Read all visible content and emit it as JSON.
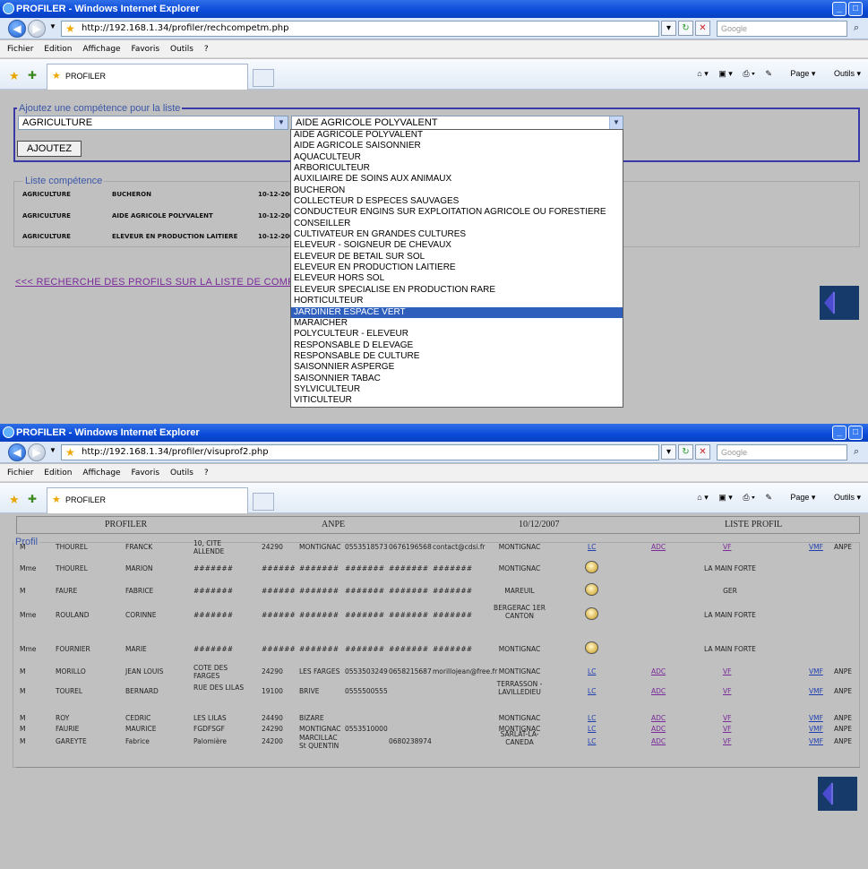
{
  "windows": [
    {
      "title": "PROFILER - Windows Internet Explorer",
      "url": "http://192.168.1.34/profiler/rechcompetm.php",
      "search_placeholder": "Google",
      "menu": [
        "Fichier",
        "Edition",
        "Affichage",
        "Favoris",
        "Outils",
        "?"
      ],
      "tab_label": "PROFILER",
      "tools": [
        "Page",
        "Outils"
      ]
    },
    {
      "title": "PROFILER - Windows Internet Explorer",
      "url": "http://192.168.1.34/profiler/visuprof2.php",
      "search_placeholder": "Google",
      "menu": [
        "Fichier",
        "Edition",
        "Affichage",
        "Favoris",
        "Outils",
        "?"
      ],
      "tab_label": "PROFILER",
      "tools": [
        "Page",
        "Outils"
      ]
    }
  ],
  "form": {
    "legend": "Ajoutez une compétence pour la liste",
    "domain_value": "AGRICULTURE",
    "metier_value": "AIDE AGRICOLE POLYVALENT",
    "button": "AJOUTEZ"
  },
  "liste": {
    "legend": "Liste compétence",
    "rows": [
      [
        "AGRICULTURE",
        "BUCHERON",
        "10-12-200"
      ],
      [
        "AGRICULTURE",
        "AIDE AGRICOLE POLYVALENT",
        "10-12-200"
      ],
      [
        "AGRICULTURE",
        "ELEVEUR EN PRODUCTION LAITIERE",
        "10-12-200"
      ]
    ]
  },
  "link_recherche": "<<< RECHERCHE DES PROFILS SUR LA LISTE DE COMPE",
  "dropdown": {
    "selected_index": 16,
    "options": [
      "AIDE AGRICOLE POLYVALENT",
      "AIDE AGRICOLE SAISONNIER",
      "AQUACULTEUR",
      "ARBORICULTEUR",
      "AUXILIAIRE DE SOINS AUX ANIMAUX",
      "BUCHERON",
      "COLLECTEUR D ESPECES SAUVAGES",
      "CONDUCTEUR ENGINS SUR EXPLOITATION AGRICOLE OU FORESTIERE",
      "CONSEILLER",
      "CULTIVATEUR EN GRANDES CULTURES",
      "ELEVEUR - SOIGNEUR DE CHEVAUX",
      "ELEVEUR DE BETAIL SUR SOL",
      "ELEVEUR EN PRODUCTION LAITIERE",
      "ELEVEUR HORS SOL",
      "ELEVEUR SPECIALISE EN PRODUCTION RARE",
      "HORTICULTEUR",
      "JARDINIER ESPACE VERT",
      "MARAICHER",
      "POLYCULTEUR - ELEVEUR",
      "RESPONSABLE D ELEVAGE",
      "RESPONSABLE DE CULTURE",
      "SAISONNIER ASPERGE",
      "SAISONNIER TABAC",
      "SYLVICULTEUR",
      "VITICULTEUR"
    ]
  },
  "header2": {
    "profiler": "PROFILER",
    "anpe": "ANPE",
    "date": "10/12/2007",
    "liste_profil": "LISTE PROFIL"
  },
  "profil": {
    "legend": "Profil",
    "rows": [
      {
        "civ": "M",
        "nom": "THOUREL",
        "prenom": "FRANCK",
        "adr": "10, CITE ALLENDE",
        "cp": "24290",
        "ville": "MONTIGNAC",
        "tel1": "0553518573",
        "tel2": "0676196568",
        "mail": "contact@cdsi.fr",
        "canton": "MONTIGNAC",
        "lc": "LC",
        "adc": "ADC",
        "vf": "VF",
        "vmf": "VMF",
        "org": "ANPE",
        "kind": "links"
      },
      {
        "civ": "Mme",
        "nom": "THOUREL",
        "prenom": "MARION",
        "adr": "#######",
        "cp": "######",
        "ville": "#######",
        "tel1": "#######",
        "tel2": "#######",
        "mail": "#######",
        "canton": "MONTIGNAC",
        "org": "LA MAIN FORTE",
        "kind": "icon"
      },
      {
        "civ": "M",
        "nom": "FAURE",
        "prenom": "FABRICE",
        "adr": "#######",
        "cp": "######",
        "ville": "#######",
        "tel1": "#######",
        "tel2": "#######",
        "mail": "#######",
        "canton": "MAREUIL",
        "org": "GER",
        "kind": "icon"
      },
      {
        "civ": "Mme",
        "nom": "ROULAND",
        "prenom": "CORINNE",
        "adr": "#######",
        "cp": "######",
        "ville": "#######",
        "tel1": "#######",
        "tel2": "#######",
        "mail": "#######",
        "canton": "BERGERAC 1ER CANTON",
        "org": "LA MAIN FORTE",
        "kind": "icon"
      },
      {
        "civ": "Mme",
        "nom": "FOURNIER",
        "prenom": "MARIE",
        "adr": "#######",
        "cp": "######",
        "ville": "#######",
        "tel1": "#######",
        "tel2": "#######",
        "mail": "#######",
        "canton": "MONTIGNAC",
        "org": "LA MAIN FORTE",
        "kind": "icon"
      },
      {
        "civ": "M",
        "nom": "MORILLO",
        "prenom": "JEAN LOUIS",
        "adr": "COTE DES FARGES",
        "cp": "24290",
        "ville": "LES FARGES",
        "tel1": "0553503249",
        "tel2": "0658215687",
        "mail": "morillojean@free.fr",
        "canton": "MONTIGNAC",
        "lc": "LC",
        "adc": "ADC",
        "vf": "VF",
        "vmf": "VMF",
        "org": "ANPE",
        "kind": "links"
      },
      {
        "civ": "M",
        "nom": "TOUREL",
        "prenom": "BERNARD",
        "adr": "RUE DES LILAS",
        "cp": "19100",
        "ville": "BRIVE",
        "tel1": "0555500555",
        "tel2": "",
        "mail": "",
        "canton": "TERRASSON - LAVILLEDIEU",
        "lc": "LC",
        "adc": "ADC",
        "vf": "VF",
        "vmf": "VMF",
        "org": "ANPE",
        "kind": "links"
      },
      {
        "civ": "M",
        "nom": "ROY",
        "prenom": "CEDRIC",
        "adr": "LES LILAS",
        "cp": "24490",
        "ville": "BIZARE",
        "tel1": "",
        "tel2": "",
        "mail": "",
        "canton": "MONTIGNAC",
        "lc": "LC",
        "adc": "ADC",
        "vf": "VF",
        "vmf": "VMF",
        "org": "ANPE",
        "kind": "links"
      },
      {
        "civ": "M",
        "nom": "FAURIE",
        "prenom": "MAURICE",
        "adr": "FGDFSGF",
        "cp": "24290",
        "ville": "MONTIGNAC",
        "tel1": "0553510000",
        "tel2": "",
        "mail": "",
        "canton": "MONTIGNAC",
        "lc": "LC",
        "adc": "ADC",
        "vf": "VF",
        "vmf": "VMF",
        "org": "ANPE",
        "kind": "links"
      },
      {
        "civ": "M",
        "nom": "GAREYTE",
        "prenom": "Fabrice",
        "adr": "Palomière",
        "cp": "24200",
        "ville": "MARCILLAC St QUENTIN",
        "tel1": "",
        "tel2": "0680238974",
        "mail": "",
        "canton": "SARLAT-LA-CANEDA",
        "lc": "LC",
        "adc": "ADC",
        "vf": "VF",
        "vmf": "VMF",
        "org": "ANPE",
        "kind": "links"
      }
    ]
  },
  "colors": {
    "titlebar": "#0a4ad8",
    "selected": "#2e5fbd",
    "link": "#1f3fb0",
    "visited": "#7a2a9a",
    "back_block": "#163a69"
  }
}
